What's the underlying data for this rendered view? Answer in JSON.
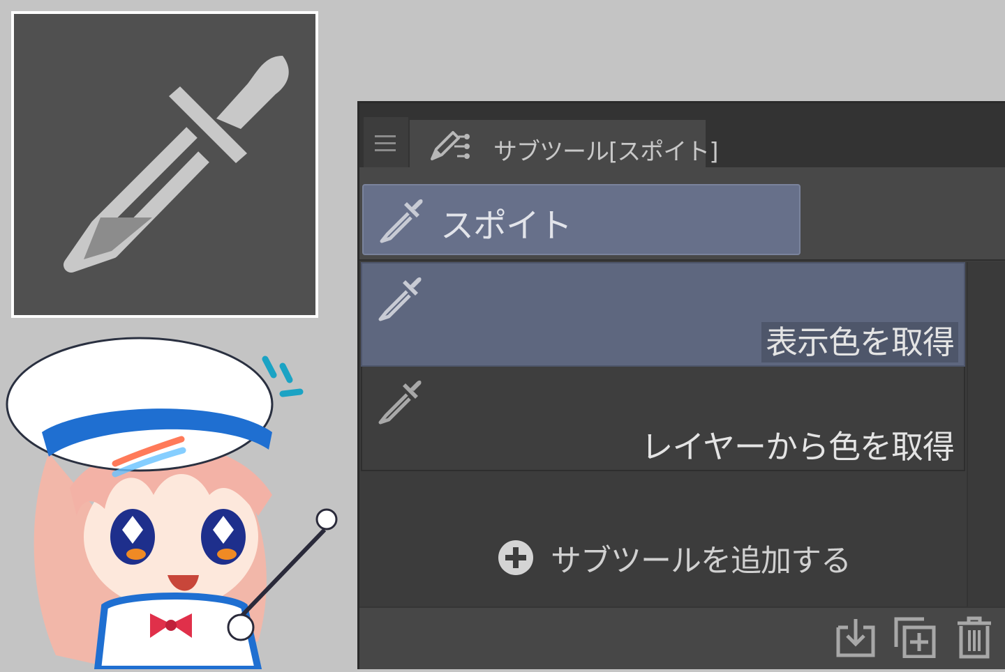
{
  "icon_card": {
    "icon": "eyedropper-icon"
  },
  "panel": {
    "tab": {
      "label": "サブツール[スポイト]",
      "icon": "subtool-brush-icon"
    },
    "group": {
      "label": "スポイト",
      "icon": "eyedropper-icon"
    },
    "subtools": [
      {
        "label": "表示色を取得",
        "icon": "eyedropper-icon",
        "selected": true
      },
      {
        "label": "レイヤーから色を取得",
        "icon": "eyedropper-icon",
        "selected": false
      }
    ],
    "add_subtool": {
      "label": "サブツールを追加する",
      "icon": "plus-circle-icon"
    },
    "footer": [
      "import-icon",
      "duplicate-icon",
      "trash-icon"
    ]
  },
  "colors": {
    "background": "#c4c4c4",
    "panel": "#3c3c3c",
    "selected": "#5e677f",
    "group_selected": "#67708a"
  }
}
